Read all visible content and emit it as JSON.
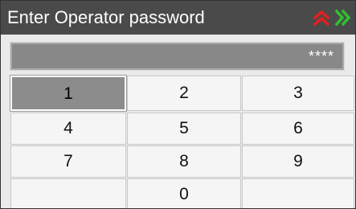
{
  "dialog": {
    "title": "Enter Operator password",
    "icons": {
      "up": {
        "name": "double-chevron-up-icon",
        "color": "#e02020"
      },
      "forward": {
        "name": "double-chevron-right-icon",
        "color": "#30c030"
      }
    }
  },
  "password": {
    "value": "****"
  },
  "keypad": {
    "keys": [
      {
        "label": "1",
        "active": true
      },
      {
        "label": "2"
      },
      {
        "label": "3"
      },
      {
        "label": "4"
      },
      {
        "label": "5"
      },
      {
        "label": "6"
      },
      {
        "label": "7"
      },
      {
        "label": "8"
      },
      {
        "label": "9"
      },
      {
        "label": ""
      },
      {
        "label": "0"
      },
      {
        "label": ""
      }
    ]
  }
}
